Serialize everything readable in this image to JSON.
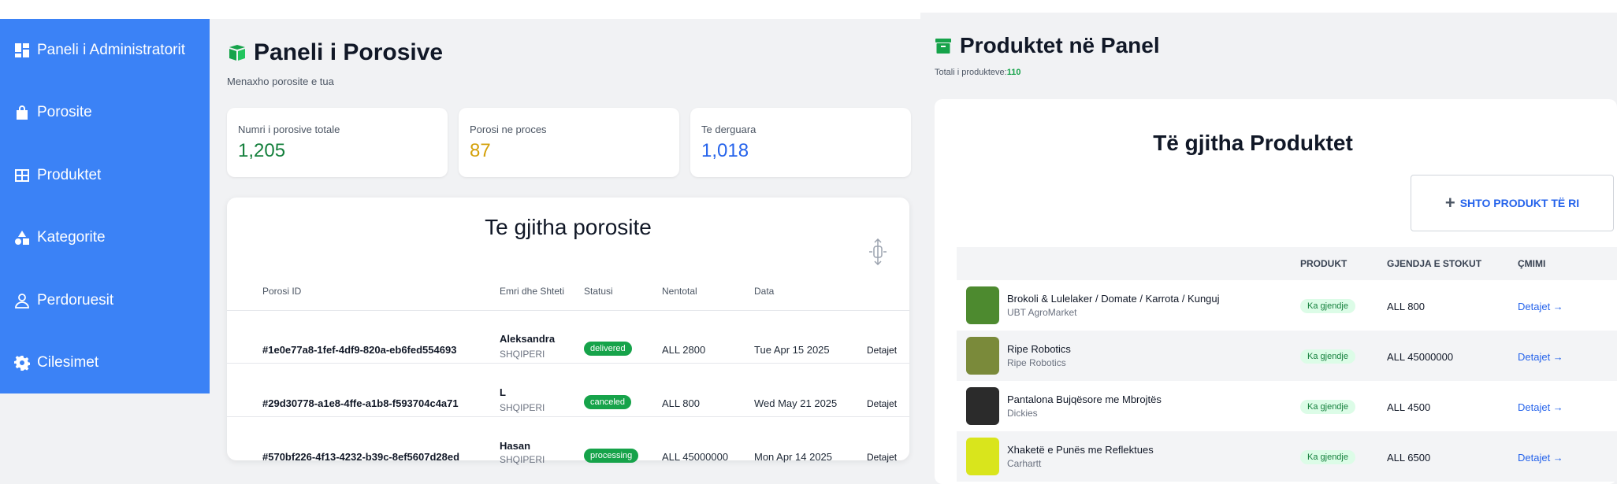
{
  "sidebar": {
    "items": [
      {
        "label": "Paneli i Administratorit",
        "icon": "dashboard-icon"
      },
      {
        "label": "Porosite",
        "icon": "shopping-bag-icon"
      },
      {
        "label": "Produktet",
        "icon": "grid-icon"
      },
      {
        "label": "Kategorite",
        "icon": "shapes-icon"
      },
      {
        "label": "Perdoruesit",
        "icon": "user-icon"
      },
      {
        "label": "Cilesimet",
        "icon": "gear-icon"
      }
    ]
  },
  "orders": {
    "title": "Paneli i Porosive",
    "subtitle": "Menaxho porosite e tua",
    "stats": [
      {
        "label": "Numri i porosive totale",
        "value": "1,205",
        "color": "#15803d"
      },
      {
        "label": "Porosi ne proces",
        "value": "87",
        "color": "#d4a10b"
      },
      {
        "label": "Te derguara",
        "value": "1,018",
        "color": "#2563eb"
      }
    ],
    "table_title": "Te gjitha porosite",
    "columns": [
      "Porosi ID",
      "Emri dhe Shteti",
      "Statusi",
      "Nentotal",
      "Data"
    ],
    "rows": [
      {
        "id": "#1e0e77a8-1fef-4df9-820a-eb6fed554693",
        "name": "Aleksandra",
        "country": "SHQIPERI",
        "status": "delivered",
        "subtotal": "ALL 2800",
        "date": "Tue Apr 15 2025",
        "action": "Detajet"
      },
      {
        "id": "#29d30778-a1e8-4ffe-a1b8-f593704c4a71",
        "name": "L",
        "country": "SHQIPERI",
        "status": "canceled",
        "subtotal": "ALL 800",
        "date": "Wed May 21 2025",
        "action": "Detajet"
      },
      {
        "id": "#570bf226-4f13-4232-b39c-8ef5607d28ed",
        "name": "Hasan",
        "country": "SHQIPERI",
        "status": "processing",
        "subtotal": "ALL 45000000",
        "date": "Mon Apr 14 2025",
        "action": "Detajet"
      }
    ]
  },
  "products": {
    "title": "Produktet në Panel",
    "total_label": "Totali i produkteve:",
    "total_value": "110",
    "card_title": "Të gjitha Produktet",
    "add_button": "SHTO PRODUKT TË RI",
    "columns": [
      "PRODUKT",
      "GJENDJA E STOKUT",
      "ÇMIMI"
    ],
    "rows": [
      {
        "name": "Brokoli & Lulelaker / Domate / Karrota / Kunguj",
        "brand": "UBT AgroMarket",
        "stock": "Ka gjendje",
        "price": "ALL 800",
        "action": "Detajet →",
        "thumb_color": "#4d8a2f"
      },
      {
        "name": "Ripe Robotics",
        "brand": "Ripe Robotics",
        "stock": "Ka gjendje",
        "price": "ALL 45000000",
        "action": "Detajet →",
        "thumb_color": "#7a8a3a"
      },
      {
        "name": "Pantalona Bujqësore me Mbrojtës",
        "brand": "Dickies",
        "stock": "Ka gjendje",
        "price": "ALL 4500",
        "action": "Detajet →",
        "thumb_color": "#2b2b2b"
      },
      {
        "name": "Xhaketë e Punës me Reflektues",
        "brand": "Carhartt",
        "stock": "Ka gjendje",
        "price": "ALL 6500",
        "action": "Detajet →",
        "thumb_color": "#d9e51c"
      }
    ]
  }
}
